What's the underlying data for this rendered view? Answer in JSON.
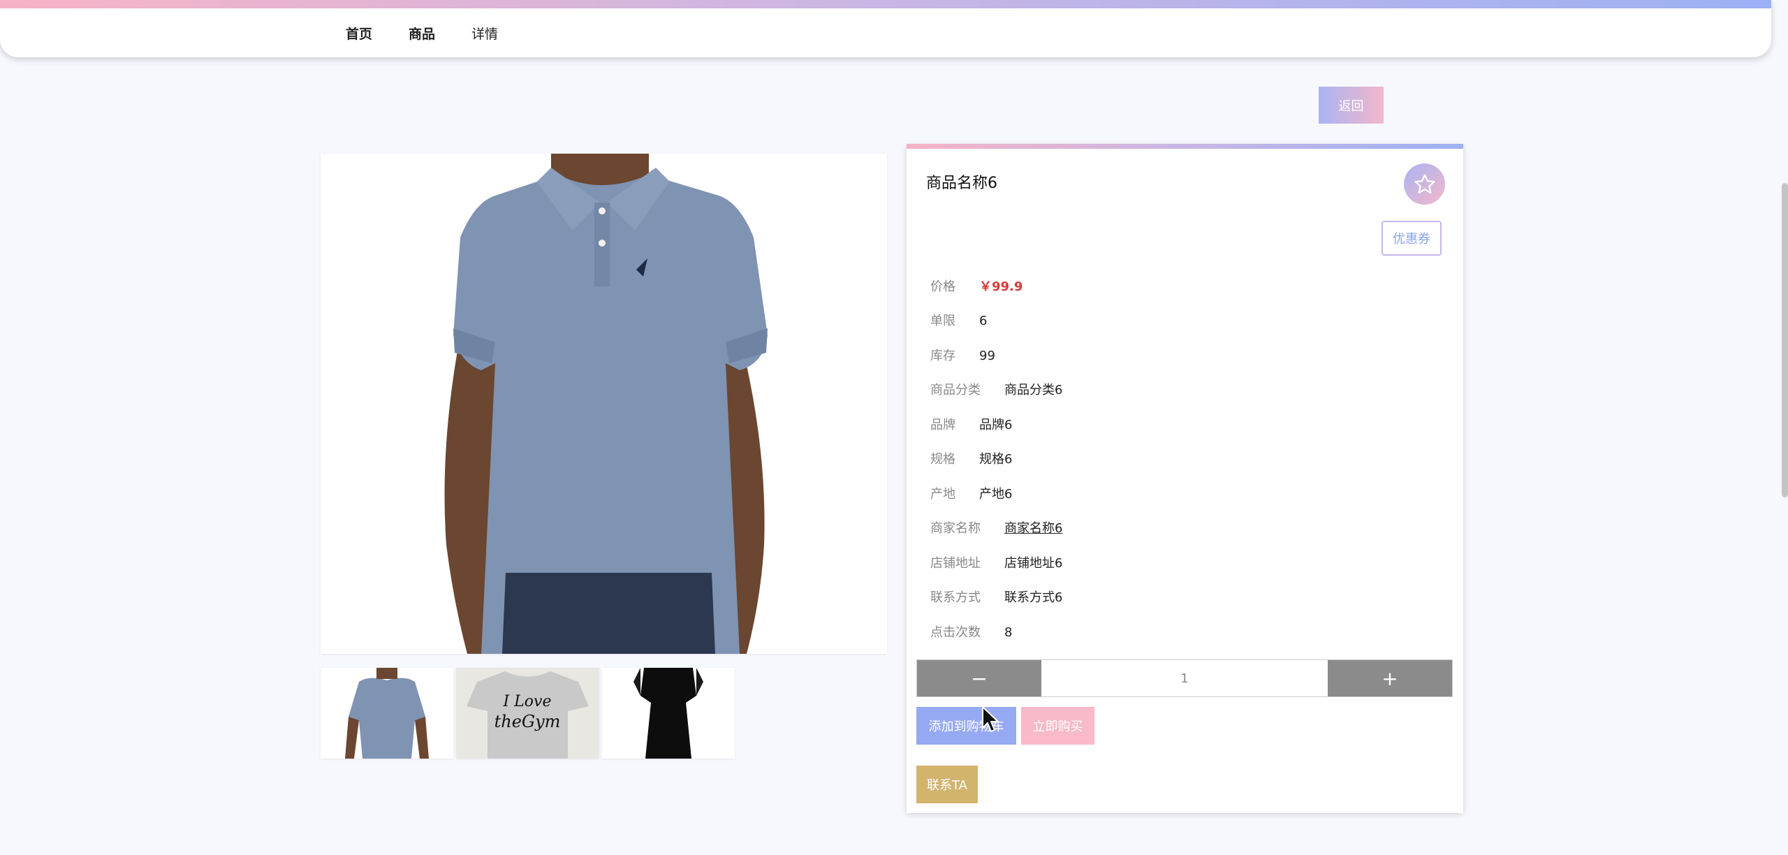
{
  "nav": {
    "items": [
      "首页",
      "商品",
      "详情"
    ]
  },
  "back_label": "返回",
  "product": {
    "name": "商品名称6",
    "coupon_label": "优惠券",
    "fields": [
      {
        "key": "价格",
        "value": "￥99.9"
      },
      {
        "key": "单限",
        "value": "6"
      },
      {
        "key": "库存",
        "value": "99"
      },
      {
        "key": "商品分类",
        "value": "商品分类6"
      },
      {
        "key": "品牌",
        "value": "品牌6"
      },
      {
        "key": "规格",
        "value": "规格6"
      },
      {
        "key": "产地",
        "value": "产地6"
      },
      {
        "key": "商家名称",
        "value": "商家名称6"
      },
      {
        "key": "店铺地址",
        "value": "店铺地址6"
      },
      {
        "key": "联系方式",
        "value": "联系方式6"
      },
      {
        "key": "点击次数",
        "value": "8"
      }
    ]
  },
  "stepper": {
    "minus": "−",
    "plus": "+",
    "quantity": "1"
  },
  "actions": {
    "add_to_cart": "添加到购物车",
    "buy_now": "立即购买",
    "contact": "联系TA"
  },
  "icons": {
    "favorite": "star-icon"
  },
  "colors": {
    "accent_pink": "#f3b7cb",
    "accent_blue": "#a9b4f2",
    "price": "#d63b3b",
    "contact": "#d3b46d"
  }
}
